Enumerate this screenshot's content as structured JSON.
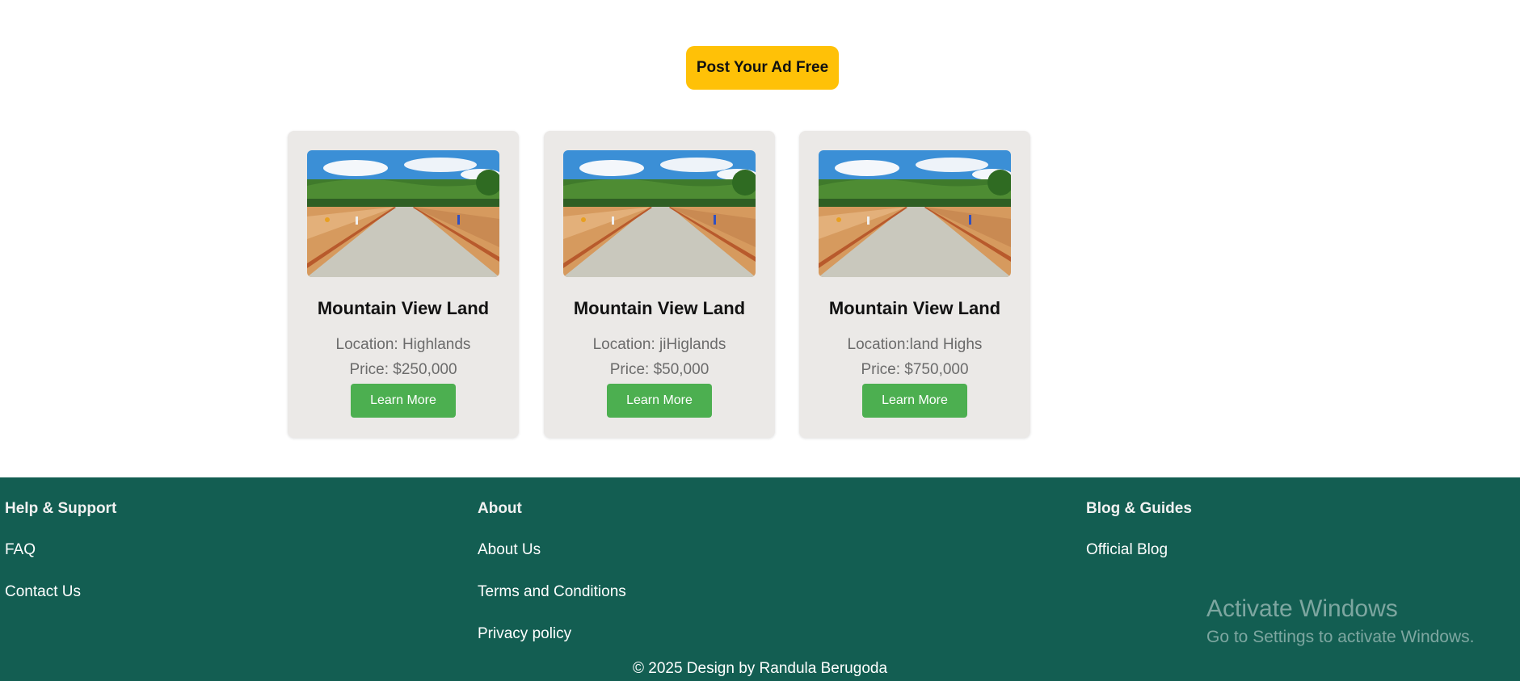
{
  "cta": {
    "label": "Post Your Ad Free"
  },
  "listings": [
    {
      "title": "Mountain View Land",
      "location": "Location: Highlands",
      "price": "Price: $250,000",
      "button": "Learn More"
    },
    {
      "title": "Mountain View Land",
      "location": "Location: jiHiglands",
      "price": "Price: $50,000",
      "button": "Learn More"
    },
    {
      "title": "Mountain View Land",
      "location": "Location:land Highs",
      "price": "Price: $750,000",
      "button": "Learn More"
    }
  ],
  "footer": {
    "help": {
      "heading": "Help & Support",
      "links": [
        "FAQ",
        "Contact Us"
      ]
    },
    "about": {
      "heading": "About",
      "links": [
        "About Us",
        "Terms and Conditions",
        "Privacy policy"
      ]
    },
    "blog": {
      "heading": "Blog & Guides",
      "links": [
        "Official Blog"
      ]
    },
    "copyright": "© 2025 Design by Randula Berugoda"
  },
  "watermark": {
    "line1": "Activate Windows",
    "line2": "Go to Settings to activate Windows."
  },
  "colors": {
    "cta": "#ffc107",
    "button": "#4caf50",
    "footer": "#135e52",
    "card": "#ebe9e7"
  }
}
